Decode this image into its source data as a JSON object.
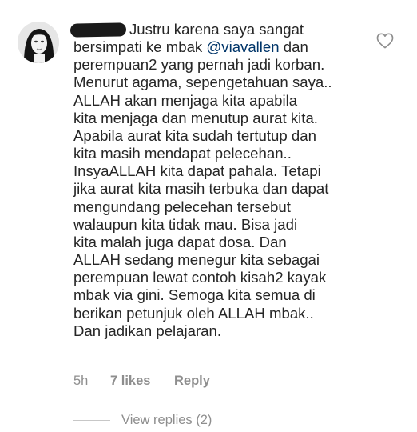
{
  "comment": {
    "lines": [
      "Justru karena saya sangat",
      "bersimpati ke mbak",
      "perempuan2 yang pernah jadi korban.",
      "Menurut agama, sepengetahuan saya..",
      "ALLAH akan menjaga kita apabila",
      "kita menjaga dan menutup aurat kita.",
      "Apabila aurat kita sudah tertutup dan",
      "kita masih mendapat pelecehan..",
      "InsyaALLAH kita dapat pahala. Tetapi",
      "jika aurat kita masih terbuka dan dapat",
      "mengundang pelecehan tersebut",
      "walaupun kita tidak mau. Bisa jadi",
      "kita malah juga dapat dosa.  Dan",
      "ALLAH sedang menegur kita sebagai",
      "perempuan lewat contoh kisah2 kayak",
      "mbak via gini. Semoga kita semua di",
      "berikan petunjuk oleh ALLAH mbak..",
      "Dan jadikan pelajaran."
    ],
    "mention": "@viavallen",
    "after_mention": "dan"
  },
  "meta": {
    "time": "5h",
    "likes": "7 likes",
    "reply": "Reply"
  },
  "replies": {
    "label": "View replies (2)"
  },
  "icons": {
    "like": "heart-outline-icon"
  },
  "colors": {
    "text": "#262626",
    "muted": "#8e8e8e",
    "mention": "#003569"
  }
}
